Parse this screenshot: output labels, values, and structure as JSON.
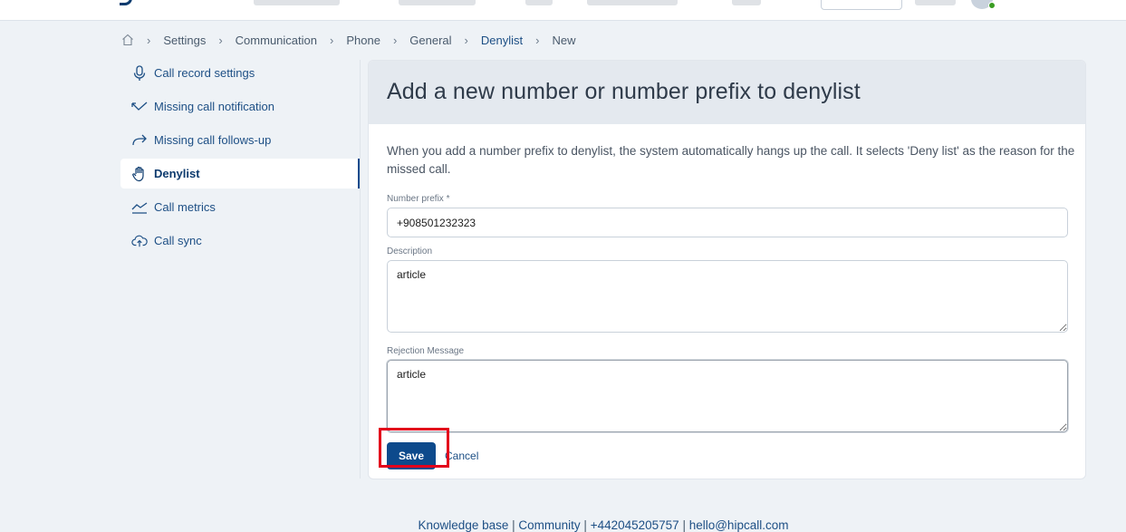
{
  "breadcrumb": {
    "items": [
      "Settings",
      "Communication",
      "Phone",
      "General",
      "Denylist",
      "New"
    ]
  },
  "sidebar": {
    "items": [
      {
        "label": "Call record settings",
        "icon": "microphone-icon"
      },
      {
        "label": "Missing call notification",
        "icon": "missed-call-icon"
      },
      {
        "label": "Missing call follows-up",
        "icon": "forward-arrow-icon"
      },
      {
        "label": "Denylist",
        "icon": "hand-icon",
        "active": true
      },
      {
        "label": "Call metrics",
        "icon": "chart-line-icon"
      },
      {
        "label": "Call sync",
        "icon": "cloud-upload-icon"
      }
    ]
  },
  "form": {
    "title": "Add a new number or number prefix to denylist",
    "intro": "When you add a number prefix to denylist, the system automatically hangs up the call. It selects 'Deny list' as the reason for the missed call.",
    "number_prefix_label": "Number prefix *",
    "number_prefix_value": "+908501232323",
    "description_label": "Description",
    "description_value": "article",
    "rejection_label": "Rejection Message",
    "rejection_value": "article",
    "save_label": "Save",
    "cancel_label": "Cancel"
  },
  "footer": {
    "knowledge": "Knowledge base",
    "community": "Community",
    "phone": "+442045205757",
    "email": "hello@hipcall.com"
  },
  "colors": {
    "primary": "#0d4a8c",
    "highlight": "#e3001b",
    "background": "#eef2f6"
  }
}
